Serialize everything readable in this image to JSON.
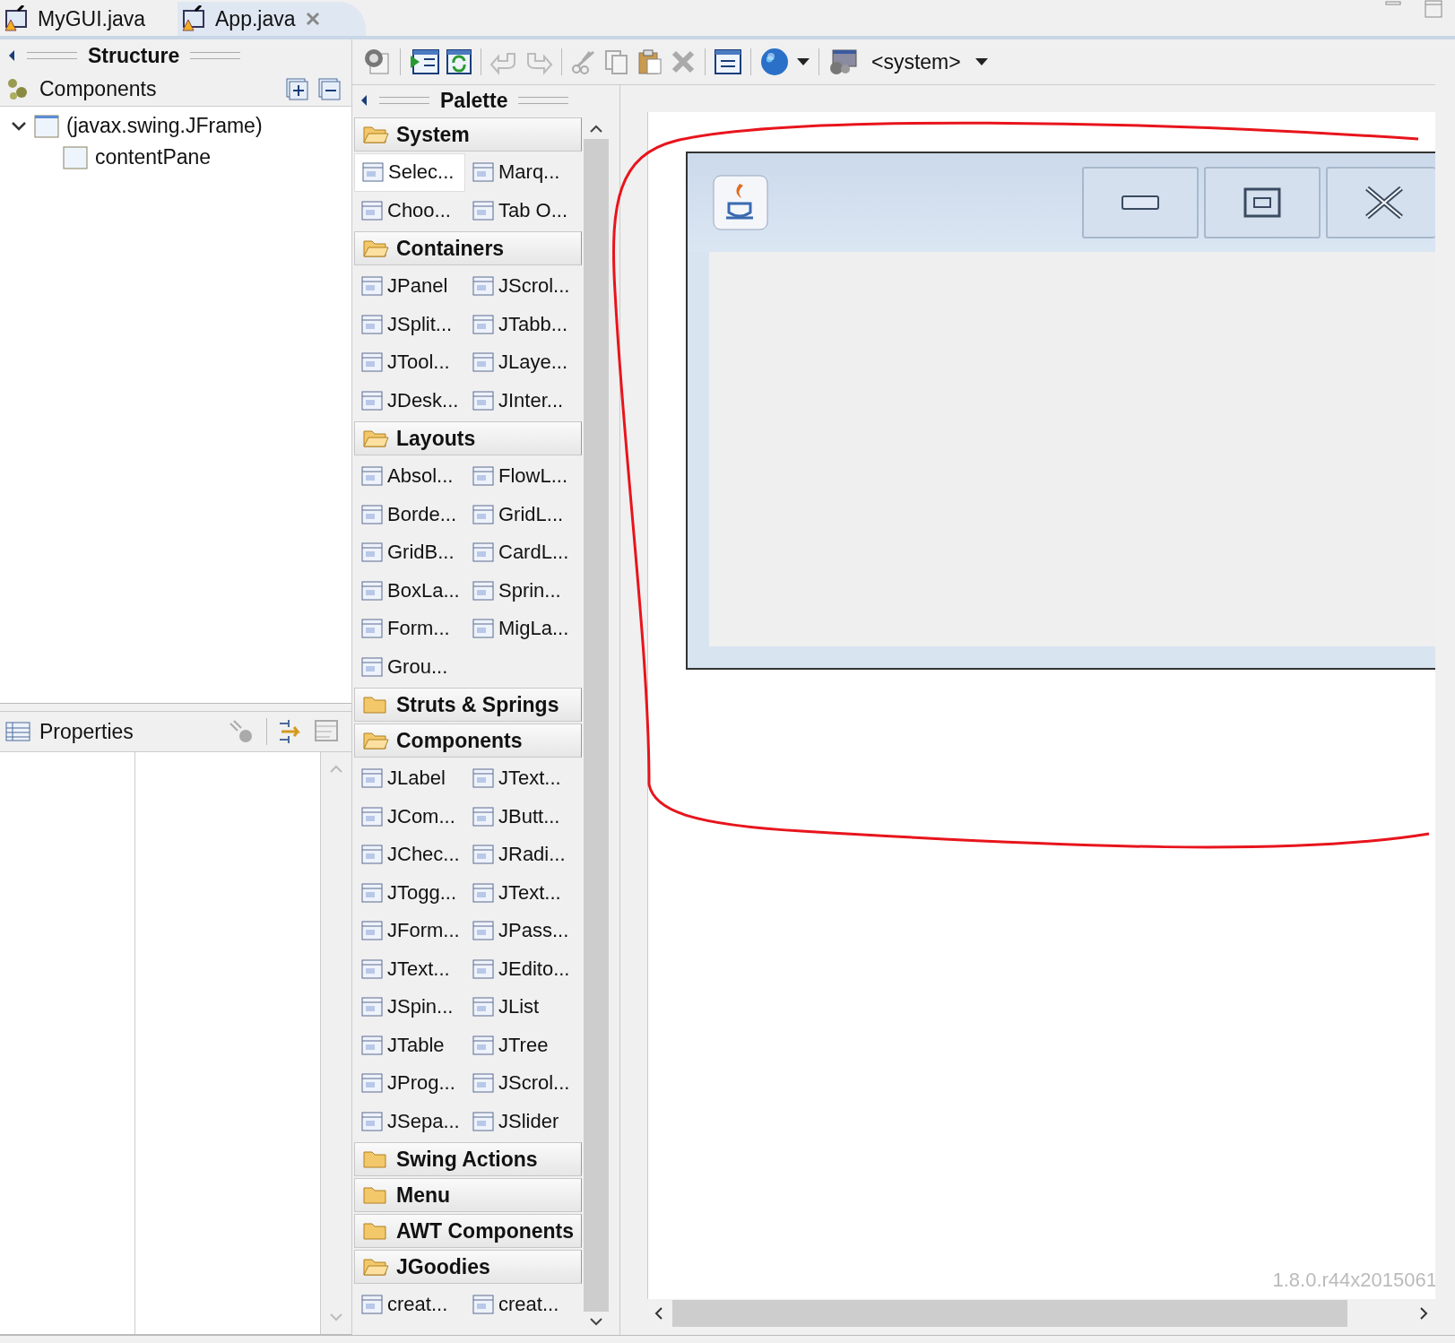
{
  "editor_tabs": [
    {
      "label": "MyGUI.java",
      "selected": false
    },
    {
      "label": "App.java",
      "selected": true
    }
  ],
  "structure": {
    "title": "Structure",
    "components_label": "Components",
    "tree": [
      {
        "label": "(javax.swing.JFrame)",
        "expanded": true,
        "children": [
          {
            "label": "contentPane"
          }
        ]
      }
    ]
  },
  "properties": {
    "title": "Properties"
  },
  "toolbar": {
    "look_and_feel": "<system>"
  },
  "palette": {
    "title": "Palette",
    "categories": [
      {
        "name": "System",
        "expanded": true,
        "items": [
          {
            "label": "Selec...",
            "selected": true
          },
          {
            "label": "Marq...",
            "selected": false
          },
          {
            "label": "Choo...",
            "selected": false
          },
          {
            "label": "Tab O...",
            "selected": false
          }
        ]
      },
      {
        "name": "Containers",
        "expanded": true,
        "items": [
          {
            "label": "JPanel",
            "selected": false
          },
          {
            "label": "JScrol...",
            "selected": false
          },
          {
            "label": "JSplit...",
            "selected": false
          },
          {
            "label": "JTabb...",
            "selected": false
          },
          {
            "label": "JTool...",
            "selected": false
          },
          {
            "label": "JLaye...",
            "selected": false
          },
          {
            "label": "JDesk...",
            "selected": false
          },
          {
            "label": "JInter...",
            "selected": false
          }
        ]
      },
      {
        "name": "Layouts",
        "expanded": true,
        "items": [
          {
            "label": "Absol...",
            "selected": false
          },
          {
            "label": "FlowL...",
            "selected": false
          },
          {
            "label": "Borde...",
            "selected": false
          },
          {
            "label": "GridL...",
            "selected": false
          },
          {
            "label": "GridB...",
            "selected": false
          },
          {
            "label": "CardL...",
            "selected": false
          },
          {
            "label": "BoxLa...",
            "selected": false
          },
          {
            "label": "Sprin...",
            "selected": false
          },
          {
            "label": "Form...",
            "selected": false
          },
          {
            "label": "MigLa...",
            "selected": false
          },
          {
            "label": "Grou...",
            "selected": false
          }
        ]
      },
      {
        "name": "Struts & Springs",
        "expanded": false
      },
      {
        "name": "Components",
        "expanded": true,
        "items": [
          {
            "label": "JLabel",
            "selected": false
          },
          {
            "label": "JText...",
            "selected": false
          },
          {
            "label": "JCom...",
            "selected": false
          },
          {
            "label": "JButt...",
            "selected": false
          },
          {
            "label": "JChec...",
            "selected": false
          },
          {
            "label": "JRadi...",
            "selected": false
          },
          {
            "label": "JTogg...",
            "selected": false
          },
          {
            "label": "JText...",
            "selected": false
          },
          {
            "label": "JForm...",
            "selected": false
          },
          {
            "label": "JPass...",
            "selected": false
          },
          {
            "label": "JText...",
            "selected": false
          },
          {
            "label": "JEdito...",
            "selected": false
          },
          {
            "label": "JSpin...",
            "selected": false
          },
          {
            "label": "JList",
            "selected": false
          },
          {
            "label": "JTable",
            "selected": false
          },
          {
            "label": "JTree",
            "selected": false
          },
          {
            "label": "JProg...",
            "selected": false
          },
          {
            "label": "JScrol...",
            "selected": false
          },
          {
            "label": "JSepa...",
            "selected": false
          },
          {
            "label": "JSlider",
            "selected": false
          }
        ]
      },
      {
        "name": "Swing Actions",
        "expanded": false
      },
      {
        "name": "Menu",
        "expanded": false
      },
      {
        "name": "AWT Components",
        "expanded": false
      },
      {
        "name": "JGoodies",
        "expanded": true,
        "items": [
          {
            "label": "creat...",
            "selected": false
          },
          {
            "label": "creat...",
            "selected": false
          }
        ]
      }
    ]
  },
  "canvas": {
    "version": "1.8.0.r44x2015061"
  }
}
